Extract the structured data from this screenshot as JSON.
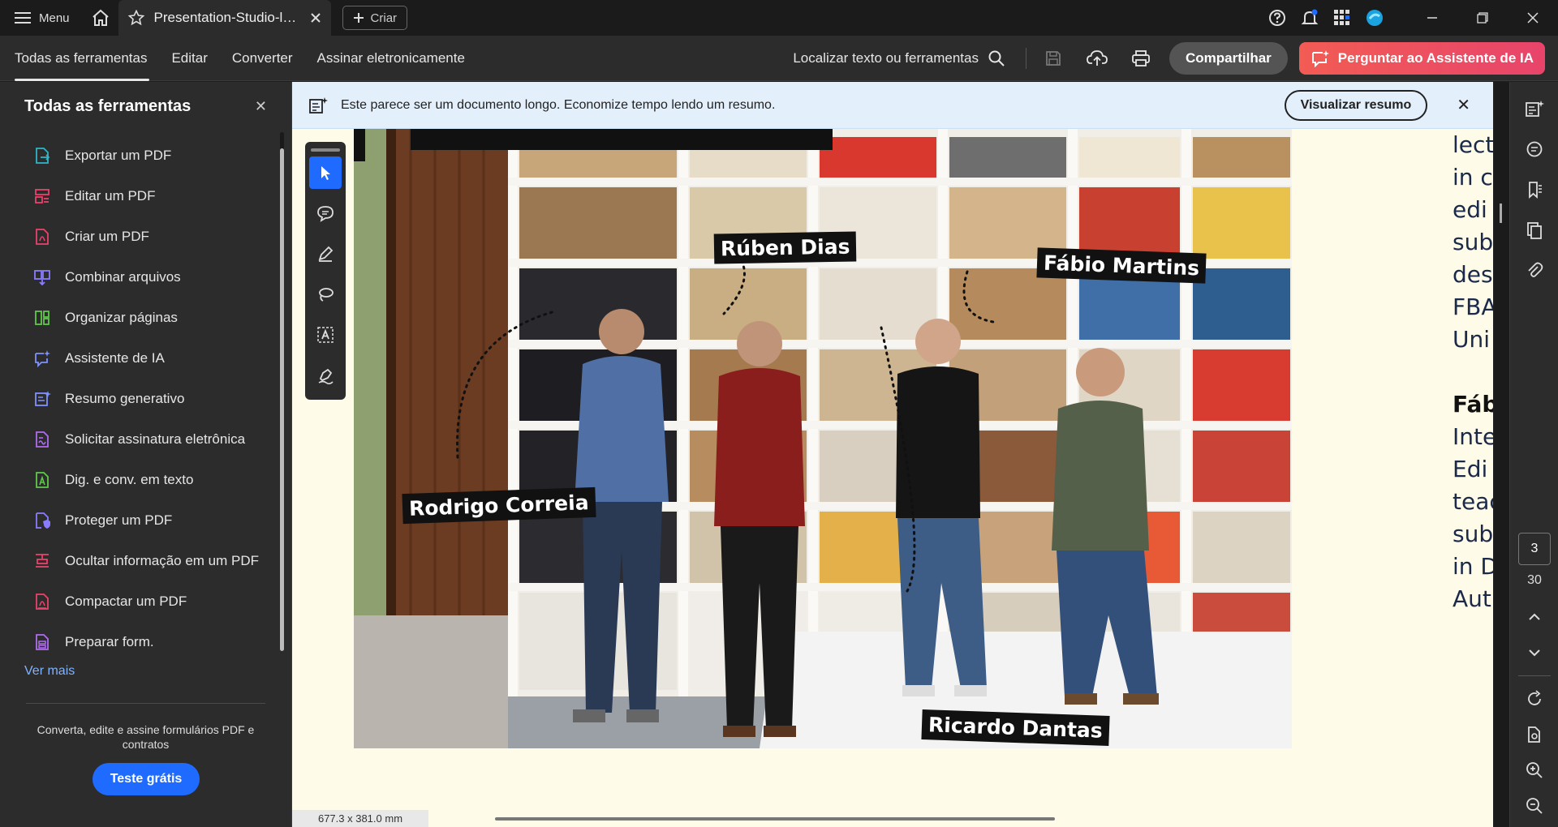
{
  "titlebar": {
    "menu_label": "Menu",
    "tab_title": "Presentation-Studio-le...",
    "new_label": "Criar"
  },
  "toolbar": {
    "nav": [
      "Todas as ferramentas",
      "Editar",
      "Converter",
      "Assinar eletronicamente"
    ],
    "search_label": "Localizar texto ou ferramentas",
    "share_label": "Compartilhar",
    "ai_label": "Perguntar ao Assistente de IA"
  },
  "sidebar": {
    "title": "Todas as ferramentas",
    "items": [
      {
        "label": "Exportar um PDF",
        "icon": "export-pdf-icon",
        "color": "#2fb6c8"
      },
      {
        "label": "Editar um PDF",
        "icon": "edit-pdf-icon",
        "color": "#e8446b"
      },
      {
        "label": "Criar um PDF",
        "icon": "create-pdf-icon",
        "color": "#e8446b"
      },
      {
        "label": "Combinar arquivos",
        "icon": "combine-files-icon",
        "color": "#8a7cff"
      },
      {
        "label": "Organizar páginas",
        "icon": "organize-pages-icon",
        "color": "#5fc94a"
      },
      {
        "label": "Assistente de IA",
        "icon": "ai-assistant-icon",
        "color": "#7f90ff"
      },
      {
        "label": "Resumo generativo",
        "icon": "generative-summary-icon",
        "color": "#7f90ff"
      },
      {
        "label": "Solicitar assinatura eletrônica",
        "icon": "request-signature-icon",
        "color": "#b06cf0"
      },
      {
        "label": "Dig. e conv. em texto",
        "icon": "scan-ocr-icon",
        "color": "#5fc94a"
      },
      {
        "label": "Proteger um PDF",
        "icon": "protect-pdf-icon",
        "color": "#8a7cff"
      },
      {
        "label": "Ocultar informação em um PDF",
        "icon": "redact-pdf-icon",
        "color": "#e8446b"
      },
      {
        "label": "Compactar um PDF",
        "icon": "compress-pdf-icon",
        "color": "#e8446b"
      },
      {
        "label": "Preparar form.",
        "icon": "prepare-form-icon",
        "color": "#b06cf0"
      }
    ],
    "more_label": "Ver mais",
    "promo_text": "Converta, edite e assine formulários PDF e contratos",
    "trial_label": "Teste grátis"
  },
  "banner": {
    "text": "Este parece ser um documento longo. Economize tempo lendo um resumo.",
    "button_label": "Visualizar resumo"
  },
  "photo": {
    "names": [
      "Rúben Dias",
      "Fábio Martins",
      "Rodrigo Correia",
      "Ricardo Dantas"
    ]
  },
  "side_text": {
    "lines": [
      "lect",
      "in c",
      "edi",
      "sub",
      "des",
      "FBA",
      "Uni",
      "",
      "Fáb",
      "Inte",
      "Edi",
      "teac",
      "sub",
      "in D",
      "Aut"
    ]
  },
  "status": {
    "dimensions": "677.3 x 381.0 mm",
    "page_current": "3",
    "page_total": "30"
  }
}
